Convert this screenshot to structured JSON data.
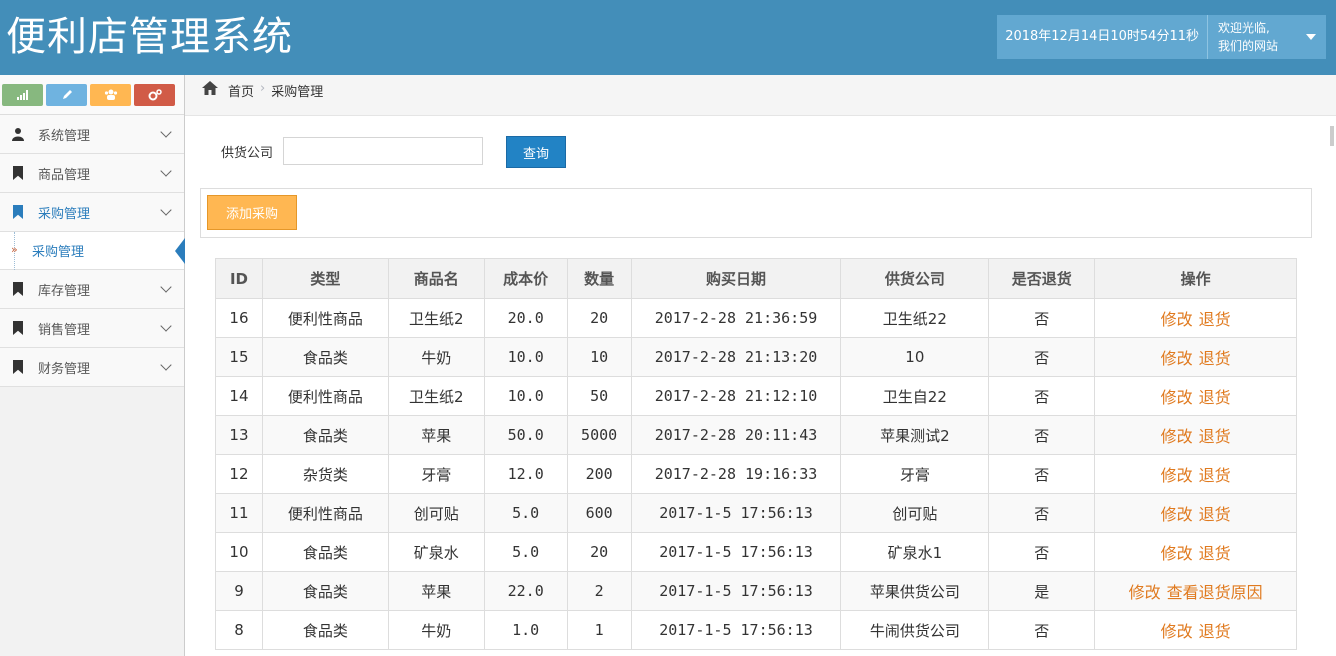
{
  "header": {
    "brand": "便利店管理系统",
    "datetime": "2018年12月14日10时54分11秒",
    "welcome_line1": "欢迎光临,",
    "welcome_line2": "我们的网站"
  },
  "sidebar": {
    "items": [
      {
        "label": "系统管理",
        "icon": "user-icon"
      },
      {
        "label": "商品管理",
        "icon": "bookmark-icon"
      },
      {
        "label": "采购管理",
        "icon": "bookmark-icon"
      },
      {
        "label": "库存管理",
        "icon": "bookmark-icon"
      },
      {
        "label": "销售管理",
        "icon": "bookmark-icon"
      },
      {
        "label": "财务管理",
        "icon": "bookmark-icon"
      }
    ],
    "sub_item": "采购管理"
  },
  "breadcrumb": {
    "home": "首页",
    "current": "采购管理"
  },
  "search": {
    "label": "供货公司",
    "value": "",
    "query_label": "查询"
  },
  "toolbar": {
    "add_label": "添加采购"
  },
  "table": {
    "headers": [
      "ID",
      "类型",
      "商品名",
      "成本价",
      "数量",
      "购买日期",
      "供货公司",
      "是否退货",
      "操作"
    ],
    "rows": [
      {
        "id": "16",
        "type": "便利性商品",
        "name": "卫生纸2",
        "price": "20.0",
        "qty": "20",
        "date": "2017-2-28 21:36:59",
        "supplier": "卫生纸22",
        "returned": "否",
        "op1": "修改",
        "op2": "退货"
      },
      {
        "id": "15",
        "type": "食品类",
        "name": "牛奶",
        "price": "10.0",
        "qty": "10",
        "date": "2017-2-28 21:13:20",
        "supplier": "10",
        "returned": "否",
        "op1": "修改",
        "op2": "退货"
      },
      {
        "id": "14",
        "type": "便利性商品",
        "name": "卫生纸2",
        "price": "10.0",
        "qty": "50",
        "date": "2017-2-28 21:12:10",
        "supplier": "卫生自22",
        "returned": "否",
        "op1": "修改",
        "op2": "退货"
      },
      {
        "id": "13",
        "type": "食品类",
        "name": "苹果",
        "price": "50.0",
        "qty": "5000",
        "date": "2017-2-28 20:11:43",
        "supplier": "苹果测试2",
        "returned": "否",
        "op1": "修改",
        "op2": "退货"
      },
      {
        "id": "12",
        "type": "杂货类",
        "name": "牙膏",
        "price": "12.0",
        "qty": "200",
        "date": "2017-2-28 19:16:33",
        "supplier": "牙膏",
        "returned": "否",
        "op1": "修改",
        "op2": "退货"
      },
      {
        "id": "11",
        "type": "便利性商品",
        "name": "创可贴",
        "price": "5.0",
        "qty": "600",
        "date": "2017-1-5 17:56:13",
        "supplier": "创可贴",
        "returned": "否",
        "op1": "修改",
        "op2": "退货"
      },
      {
        "id": "10",
        "type": "食品类",
        "name": "矿泉水",
        "price": "5.0",
        "qty": "20",
        "date": "2017-1-5 17:56:13",
        "supplier": "矿泉水1",
        "returned": "否",
        "op1": "修改",
        "op2": "退货"
      },
      {
        "id": "9",
        "type": "食品类",
        "name": "苹果",
        "price": "22.0",
        "qty": "2",
        "date": "2017-1-5 17:56:13",
        "supplier": "苹果供货公司",
        "returned": "是",
        "op1": "修改",
        "op2": "查看退货原因"
      },
      {
        "id": "8",
        "type": "食品类",
        "name": "牛奶",
        "price": "1.0",
        "qty": "1",
        "date": "2017-1-5 17:56:13",
        "supplier": "牛闹供货公司",
        "returned": "否",
        "op1": "修改",
        "op2": "退货"
      }
    ]
  }
}
